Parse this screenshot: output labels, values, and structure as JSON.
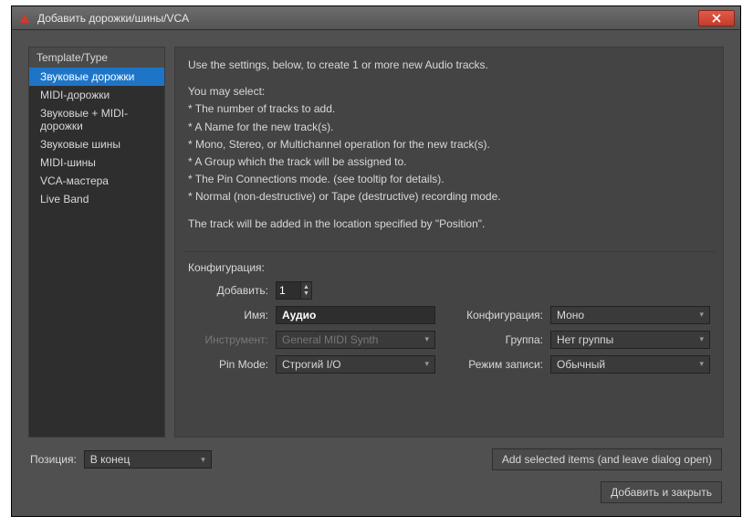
{
  "window": {
    "title": "Добавить дорожки/шины/VCA"
  },
  "sidebar": {
    "header": "Template/Type",
    "items": [
      {
        "label": "Звуковые дорожки",
        "selected": true
      },
      {
        "label": "MIDI-дорожки",
        "selected": false
      },
      {
        "label": "Звуковые + MIDI-дорожки",
        "selected": false
      },
      {
        "label": "Звуковые шины",
        "selected": false
      },
      {
        "label": "MIDI-шины",
        "selected": false
      },
      {
        "label": "VCA-мастера",
        "selected": false
      },
      {
        "label": "Live Band",
        "selected": false
      }
    ]
  },
  "info": {
    "intro": "Use the settings, below, to create 1 or more new Audio tracks.",
    "may_select": "You may select:",
    "b1": "* The number of tracks to add.",
    "b2": "* A Name for the new track(s).",
    "b3": "* Mono, Stereo, or Multichannel operation for the new track(s).",
    "b4": "* A Group which the track will be assigned to.",
    "b5": "* The Pin Connections mode. (see tooltip for details).",
    "b6": "* Normal (non-destructive) or Tape (destructive) recording mode.",
    "footer": "The track will be added in the location specified by \"Position\"."
  },
  "config": {
    "title": "Конфигурация:",
    "add_label": "Добавить:",
    "add_value": "1",
    "name_label": "Имя:",
    "name_value": "Аудио",
    "config_label": "Конфигурация:",
    "config_value": "Моно",
    "instrument_label": "Инструмент:",
    "instrument_value": "General MIDI Synth",
    "group_label": "Группа:",
    "group_value": "Нет группы",
    "pinmode_label": "Pin Mode:",
    "pinmode_value": "Строгий I/O",
    "recmode_label": "Режим записи:",
    "recmode_value": "Обычный"
  },
  "footer": {
    "position_label": "Позиция:",
    "position_value": "В конец",
    "add_keep_open": "Add selected items (and leave dialog open)",
    "add_close": "Добавить и закрыть"
  }
}
